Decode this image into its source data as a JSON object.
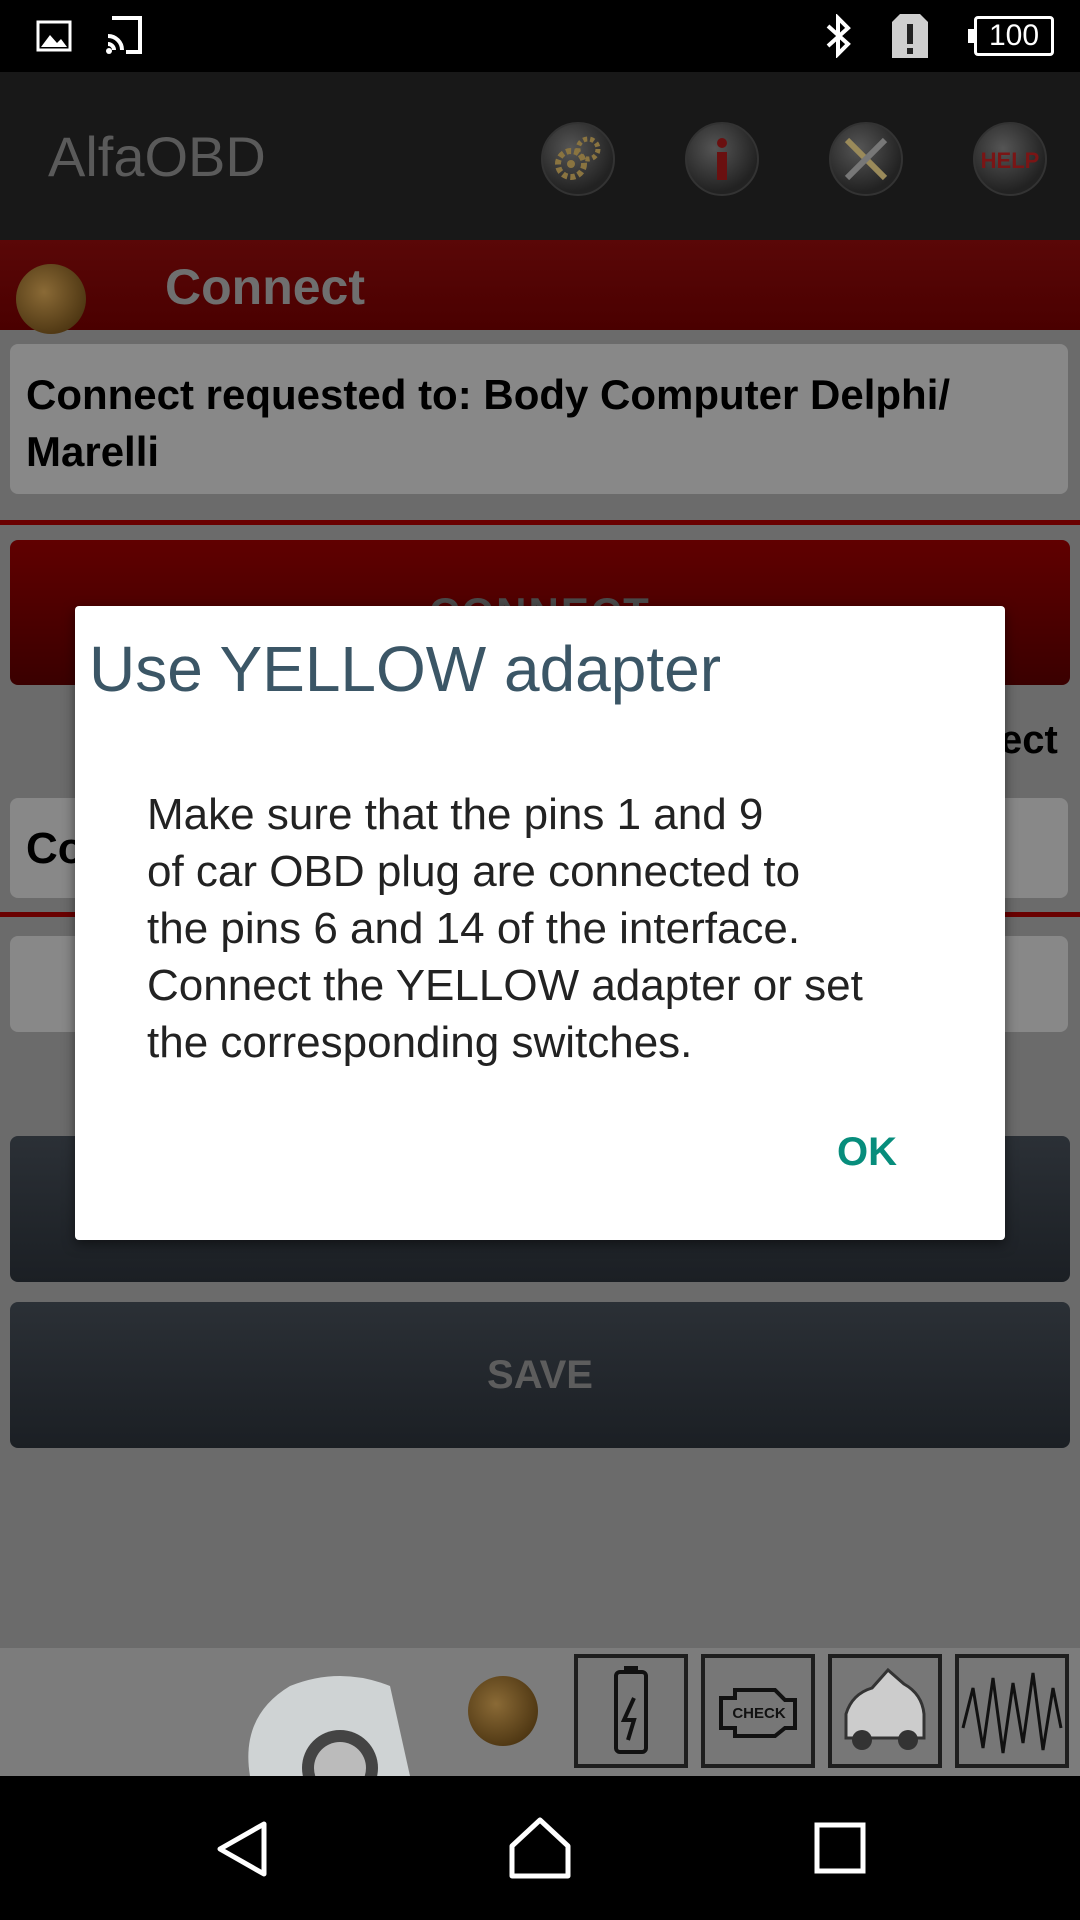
{
  "status_bar": {
    "battery_level": "100",
    "icons": [
      "image-icon",
      "cast-icon",
      "bluetooth-icon",
      "alert-icon",
      "battery-icon"
    ]
  },
  "app_bar": {
    "title": "AlfaOBD",
    "actions": [
      "settings-gears-icon",
      "info-icon",
      "tools-icon",
      "help-icon"
    ],
    "help_label": "HELP"
  },
  "page": {
    "section_title": "Connect",
    "request_text": "Connect requested to: Body Computer Delphi/ Marelli",
    "connect_button": "CONNECT",
    "partial_label_right": "ect",
    "partial_field_text": "Co",
    "save_button": "SAVE"
  },
  "bottom_strip": {
    "tools": [
      "battery-icon",
      "check-engine-icon",
      "car-hood-icon",
      "waveform-icon"
    ],
    "check_label": "CHECK"
  },
  "dialog": {
    "title": "Use YELLOW adapter",
    "message": "Make sure that the pins 1 and 9\nof car OBD plug are connected to\nthe pins 6 and 14 of the interface.\nConnect the YELLOW adapter or set\nthe corresponding switches.",
    "ok_label": "OK"
  },
  "nav_bar": {
    "buttons": [
      "back-icon",
      "home-icon",
      "recents-icon"
    ]
  },
  "colors": {
    "dialog_title": "#3b5666",
    "ok_accent": "#078d7c",
    "section_band": "#5a0707"
  }
}
